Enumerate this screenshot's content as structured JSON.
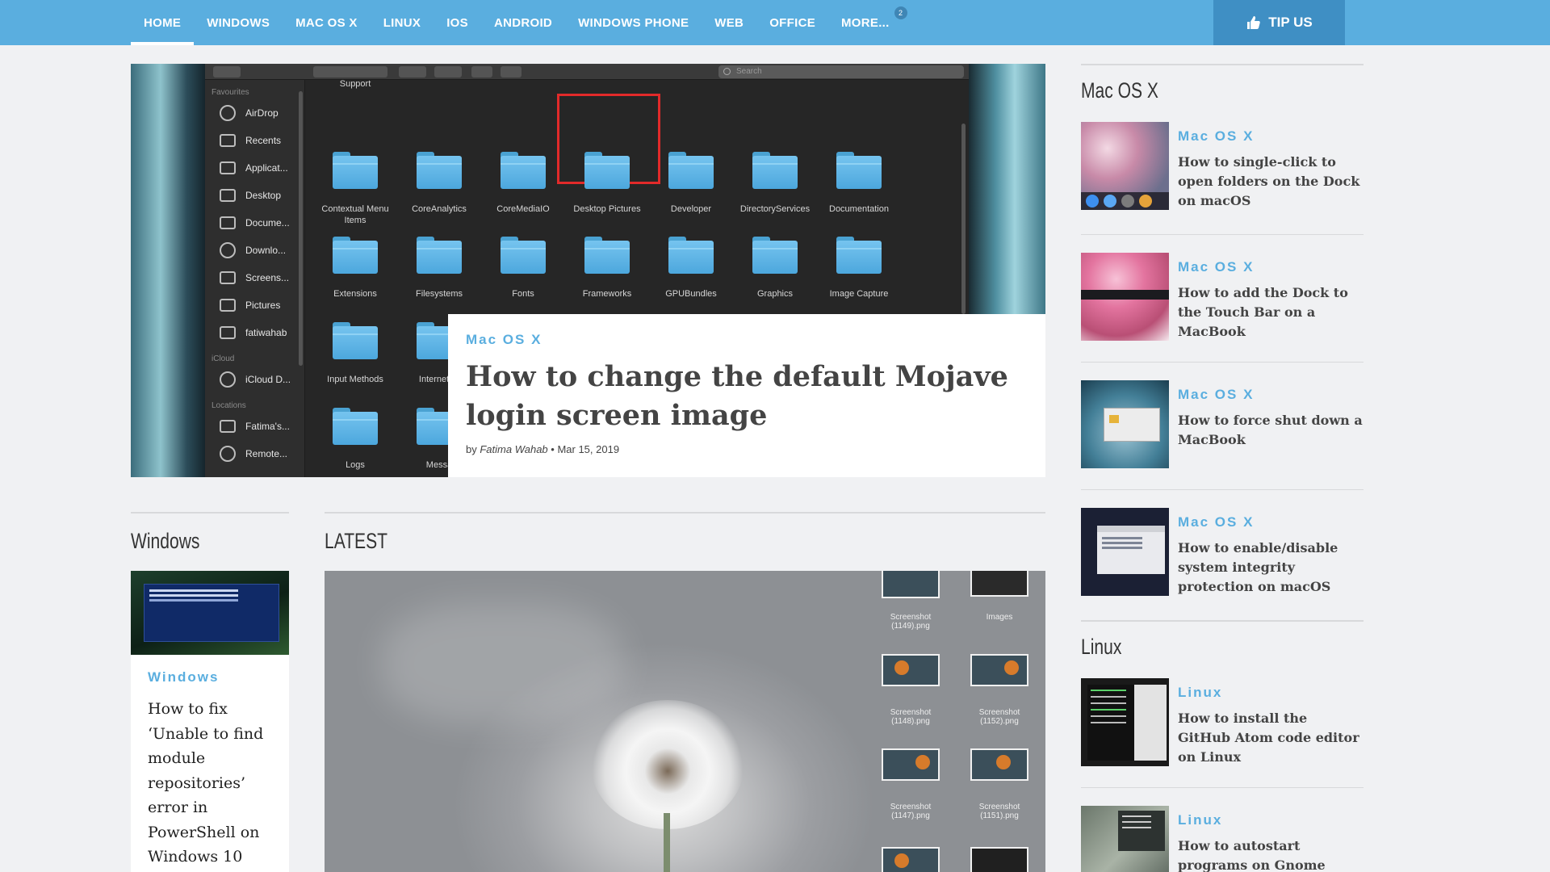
{
  "nav": {
    "items": [
      "HOME",
      "WINDOWS",
      "MAC OS X",
      "LINUX",
      "IOS",
      "ANDROID",
      "WINDOWS PHONE",
      "WEB",
      "OFFICE",
      "MORE..."
    ],
    "more_badge": "2",
    "tip_label": "TIP US"
  },
  "finder": {
    "search_placeholder": "Search",
    "sidebar": {
      "favourites_heading": "Favourites",
      "favourites": [
        "AirDrop",
        "Recents",
        "Applicat...",
        "Desktop",
        "Docume...",
        "Downlo...",
        "Screens...",
        "Pictures",
        "fatiwahab"
      ],
      "icloud_heading": "iCloud",
      "icloud": [
        "iCloud D..."
      ],
      "locations_heading": "Locations",
      "locations": [
        "Fatima's...",
        "Remote..."
      ]
    },
    "folders": [
      "Contextual Menu Items",
      "CoreAnalytics",
      "CoreMediaIO",
      "Desktop Pictures",
      "Developer",
      "DirectoryServices",
      "Documentation",
      "Extensions",
      "Filesystems",
      "Fonts",
      "Frameworks",
      "GPUBundles",
      "Graphics",
      "Image Capture",
      "Input Methods",
      "Internet Pl"
    ],
    "partial_labels": [
      "Logs",
      "Messa",
      "Support"
    ]
  },
  "hero": {
    "category": "Mac OS X",
    "title": "How to change the default Mojave login screen image",
    "by": "by",
    "author": "Fatima Wahab",
    "date": "• Mar 15, 2019"
  },
  "sections": {
    "windows": "Windows",
    "latest": "LATEST",
    "macos": "Mac OS X",
    "linux": "Linux"
  },
  "windows_card": {
    "category": "Windows",
    "title": "How to fix ‘Unable to find module repositories’ error in PowerShell on Windows 10"
  },
  "latest_image": {
    "files": [
      {
        "name": "Screenshot (1149).png"
      },
      {
        "name": "Images"
      },
      {
        "name": "Screenshot (1148).png"
      },
      {
        "name": "Screenshot (1152).png"
      },
      {
        "name": "Screenshot (1147).png"
      },
      {
        "name": "Screenshot (1151).png"
      }
    ]
  },
  "sidebar": {
    "macos_items": [
      {
        "category": "Mac OS X",
        "title": "How to single-click to open folders on the Dock on macOS"
      },
      {
        "category": "Mac OS X",
        "title": "How to add the Dock to the Touch Bar on a MacBook"
      },
      {
        "category": "Mac OS X",
        "title": "How to force shut down a MacBook"
      },
      {
        "category": "Mac OS X",
        "title": "How to enable/disable system integrity protection on macOS"
      }
    ],
    "linux_items": [
      {
        "category": "Linux",
        "title": "How to install the GitHub Atom code editor on Linux"
      },
      {
        "category": "Linux",
        "title": "How to autostart programs on Gnome Shell"
      }
    ]
  },
  "colors": {
    "nav_bg": "#5aaedf",
    "tip_bg": "#3f8fc4",
    "accent": "#5aaedf",
    "selection": "#e22a2a"
  }
}
